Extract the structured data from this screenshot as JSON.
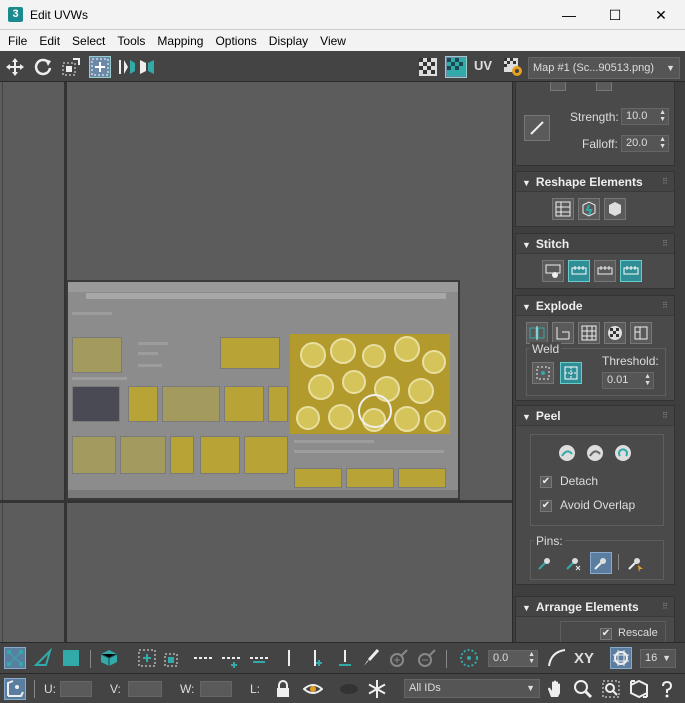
{
  "window": {
    "app_icon": "3",
    "title": "Edit UVWs",
    "minimize": "—",
    "maximize": "☐",
    "close": "✕"
  },
  "menu": [
    "File",
    "Edit",
    "Select",
    "Tools",
    "Mapping",
    "Options",
    "Display",
    "View"
  ],
  "top_toolbar": {
    "uv_label": "UV",
    "map_select": "Map #1 (Sc...90513.png)"
  },
  "panel": {
    "paint": {
      "strength_label": "Strength:",
      "strength_value": "10.0",
      "falloff_label": "Falloff:",
      "falloff_value": "20.0"
    },
    "reshape": {
      "title": "Reshape Elements"
    },
    "stitch": {
      "title": "Stitch"
    },
    "explode": {
      "title": "Explode",
      "weld_label": "Weld",
      "threshold_label": "Threshold:",
      "threshold_value": "0.01"
    },
    "peel": {
      "title": "Peel",
      "detach_label": "Detach",
      "avoid_overlap_label": "Avoid Overlap",
      "pins_label": "Pins:"
    },
    "arrange": {
      "title": "Arrange Elements",
      "rescale_label": "Rescale"
    }
  },
  "bottom_toolbar": {
    "angle_value": "0.0",
    "xy_label": "XY",
    "grid_value": "16",
    "u_label": "U:",
    "v_label": "V:",
    "w_label": "W:",
    "l_label": "L:",
    "u_value": "",
    "v_value": "",
    "w_value": "",
    "ids_select": "All IDs"
  },
  "colors": {
    "accent_teal": "#2f8e96",
    "active_blue": "#6a8aa8"
  }
}
